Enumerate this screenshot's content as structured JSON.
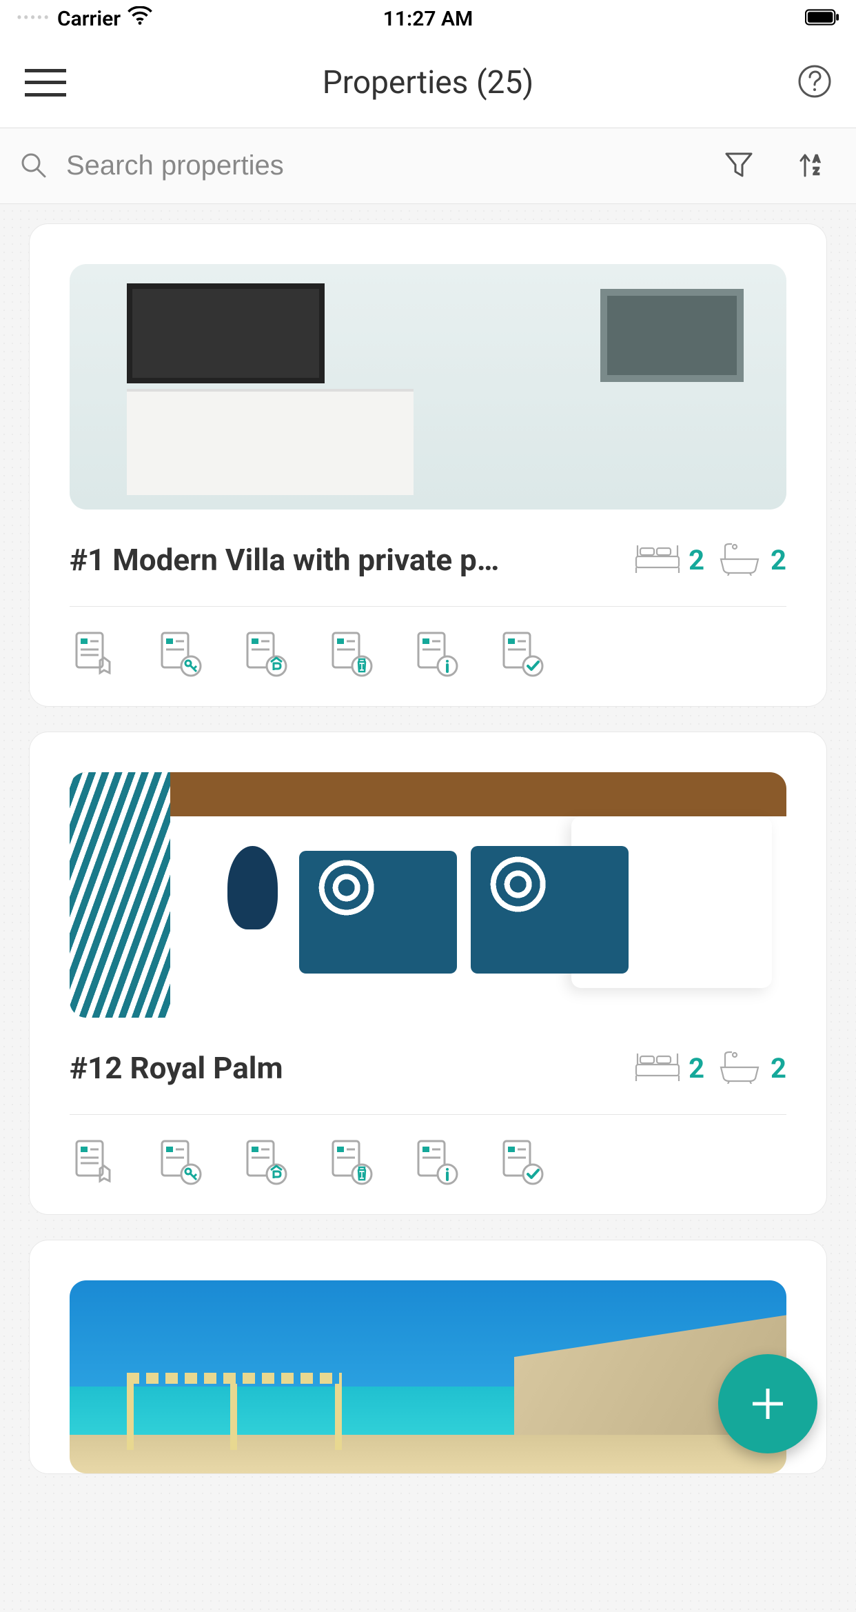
{
  "status_bar": {
    "carrier": "Carrier",
    "time": "11:27 AM"
  },
  "header": {
    "title": "Properties (25)"
  },
  "search": {
    "placeholder": "Search properties"
  },
  "accent_color": "#15a89a",
  "properties": [
    {
      "title": "#1 Modern Villa with private p…",
      "bedrooms": "2",
      "bathrooms": "2"
    },
    {
      "title": "#12 Royal Palm",
      "bedrooms": "2",
      "bathrooms": "2"
    }
  ]
}
